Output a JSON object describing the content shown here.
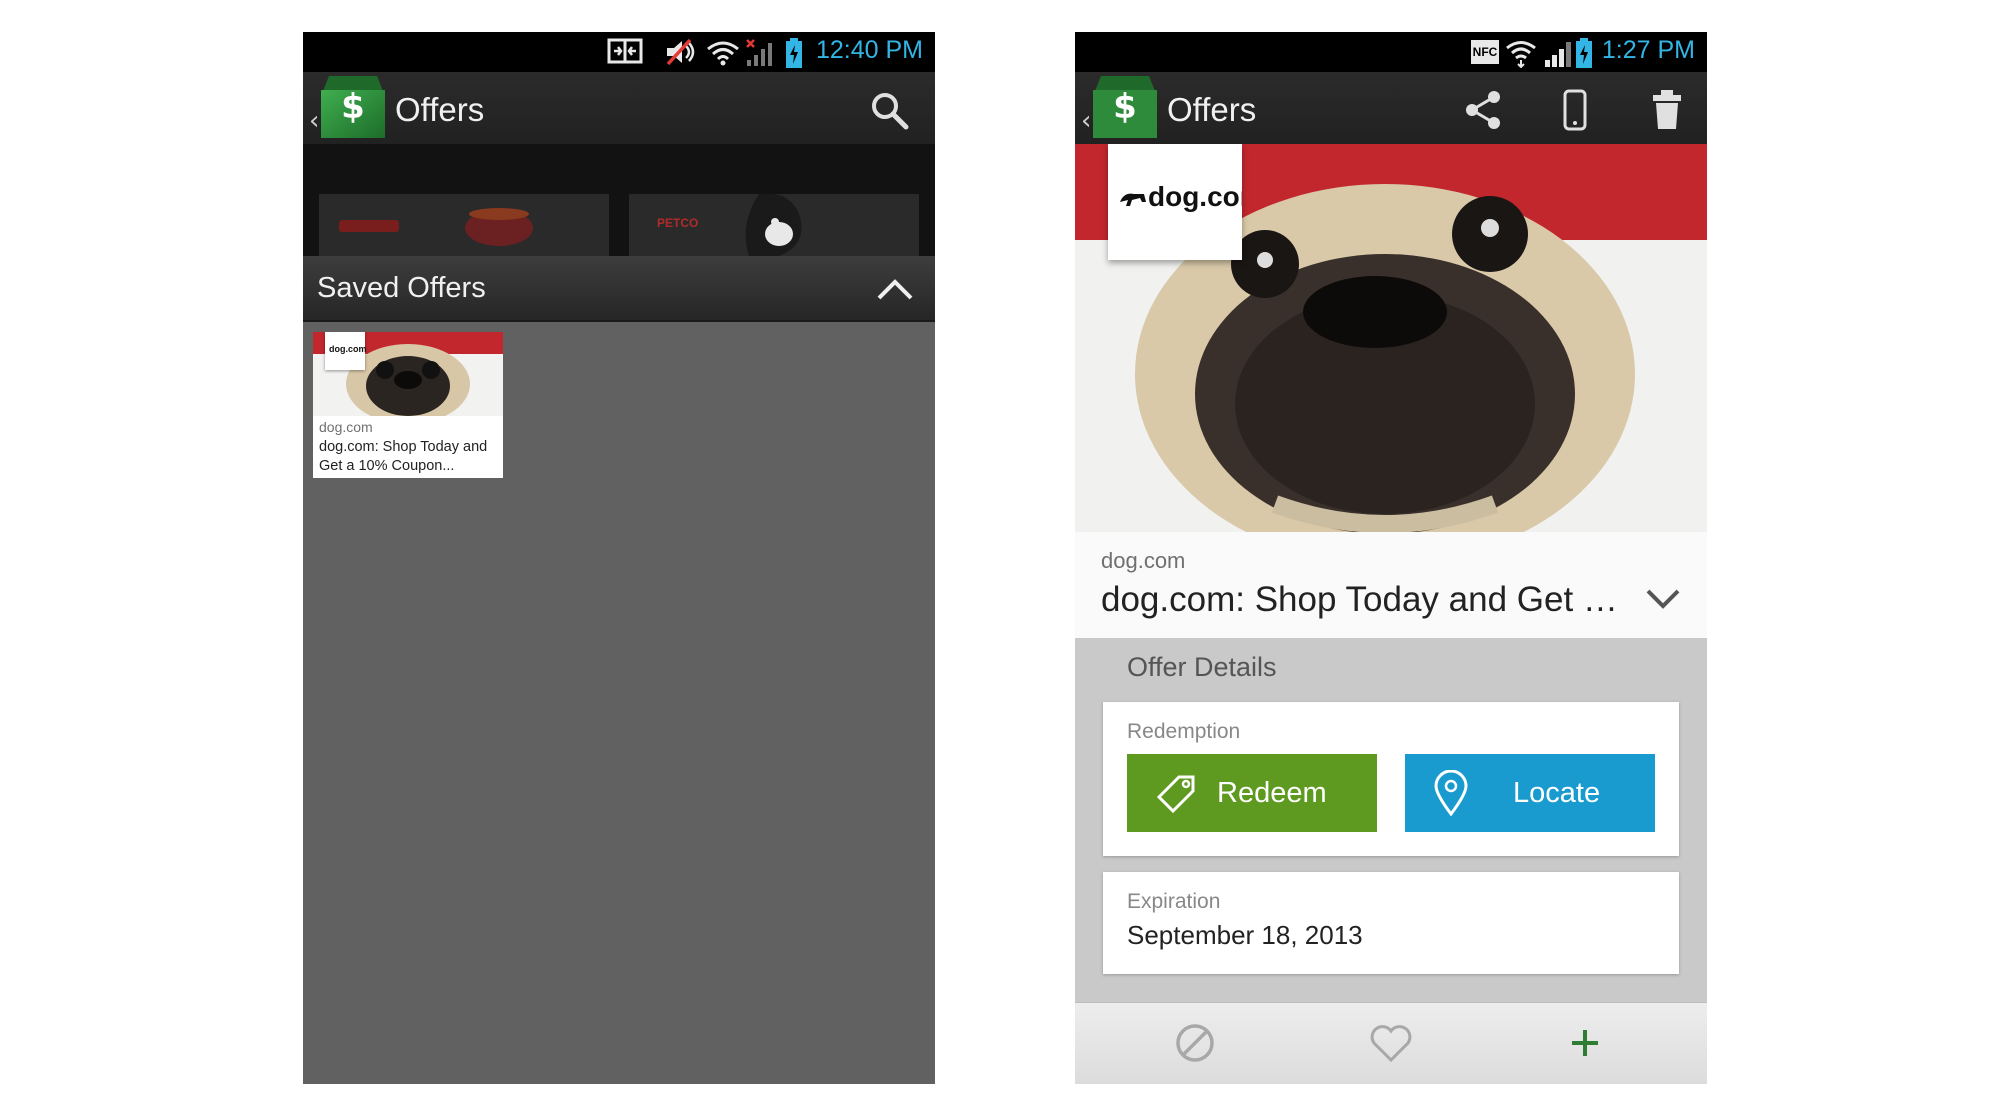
{
  "left_screen": {
    "status_bar": {
      "time": "12:40 PM"
    },
    "action_bar": {
      "title": "Offers",
      "icons": [
        "back-chevron-icon",
        "app-dollar-logo-icon",
        "search-icon"
      ]
    },
    "carousel": {
      "cards": [
        {
          "text": ""
        },
        {
          "text": "PETCO"
        }
      ]
    },
    "saved_offers": {
      "header": "Saved Offers",
      "items": [
        {
          "merchant": "dog.com",
          "title": "dog.com: Shop Today and Get a 10% Coupon..."
        }
      ]
    }
  },
  "right_screen": {
    "status_bar": {
      "time": "1:27 PM",
      "nfc_label": "NFC"
    },
    "action_bar": {
      "title": "Offers",
      "icons": [
        "share-icon",
        "phone-icon",
        "trash-icon"
      ]
    },
    "hero": {
      "merchant_logo_text": "dog.com"
    },
    "offer": {
      "merchant": "dog.com",
      "title": "dog.com: Shop Today and Get a 10% Coupon"
    },
    "details": {
      "heading": "Offer Details",
      "redemption_label": "Redemption",
      "redeem_button": "Redeem",
      "locate_button": "Locate",
      "expiration_label": "Expiration",
      "expiration_value": "September 18, 2013"
    },
    "bottom_bar": {
      "icons": [
        "not-interested-icon",
        "heart-icon",
        "add-icon"
      ]
    }
  },
  "colors": {
    "status_time": "#33b5e5",
    "redeem_green": "#5e9a1f",
    "locate_blue": "#1a9bcf",
    "add_green": "#2e7d32"
  }
}
